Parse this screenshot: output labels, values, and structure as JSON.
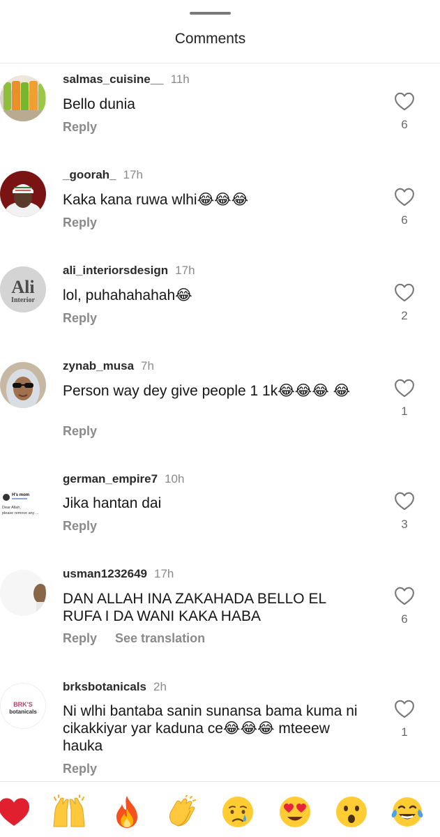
{
  "header": {
    "title": "Comments"
  },
  "comments": [
    {
      "username": "salmas_cuisine__",
      "time": "11h",
      "text": "Bello dunia",
      "reply": "Reply",
      "likes": "6"
    },
    {
      "username": "_goorah_",
      "time": "17h",
      "text": "Kaka kana ruwa wlhi😂😂😂",
      "reply": "Reply",
      "likes": "6"
    },
    {
      "username": "ali_interiorsdesign",
      "time": "17h",
      "text": "lol, puhahahahah😂",
      "reply": "Reply",
      "likes": "2"
    },
    {
      "username": "zynab_musa",
      "time": "7h",
      "text": "Person way dey give people 1 1k😂😂😂 😂",
      "reply": "Reply",
      "likes": "1"
    },
    {
      "username": "german_empire7",
      "time": "10h",
      "text": "Jika hantan dai",
      "reply": "Reply",
      "likes": "3"
    },
    {
      "username": "usman1232649",
      "time": "17h",
      "text": "DAN ALLAH INA ZAKAHADA BELLO EL RUFA I DA WANI KAKA HABA",
      "reply": "Reply",
      "translate": "See translation",
      "likes": "6"
    },
    {
      "username": "brksbotanicals",
      "time": "2h",
      "text": "Ni wlhi bantaba sanin sunansa bama kuma ni cikakkiyar yar kaduna ce😂😂😂 mteeew hauka",
      "reply": "Reply",
      "likes": "1"
    }
  ],
  "avatars": {
    "ali_logo_text": "Ali",
    "ali_logo_sub": "Interior",
    "brk_logo_line1": "BRK'S",
    "brk_logo_line2": "botanicals",
    "german_thumb_name": "H's mom",
    "german_thumb_line1": "Dear Allah,",
    "german_thumb_line2": "please remove any ..."
  },
  "quick_emojis": [
    {
      "name": "red-heart-emoji"
    },
    {
      "name": "raising-hands-emoji"
    },
    {
      "name": "fire-emoji"
    },
    {
      "name": "clapping-hands-emoji"
    },
    {
      "name": "crying-face-emoji"
    },
    {
      "name": "heart-eyes-emoji"
    },
    {
      "name": "surprised-face-emoji"
    },
    {
      "name": "tears-of-joy-emoji"
    }
  ],
  "colors": {
    "heart": "#e0202e",
    "emoji_yellow": "#ffcc33",
    "tear_blue": "#4aa3e8",
    "muted": "#8a8a8a"
  }
}
